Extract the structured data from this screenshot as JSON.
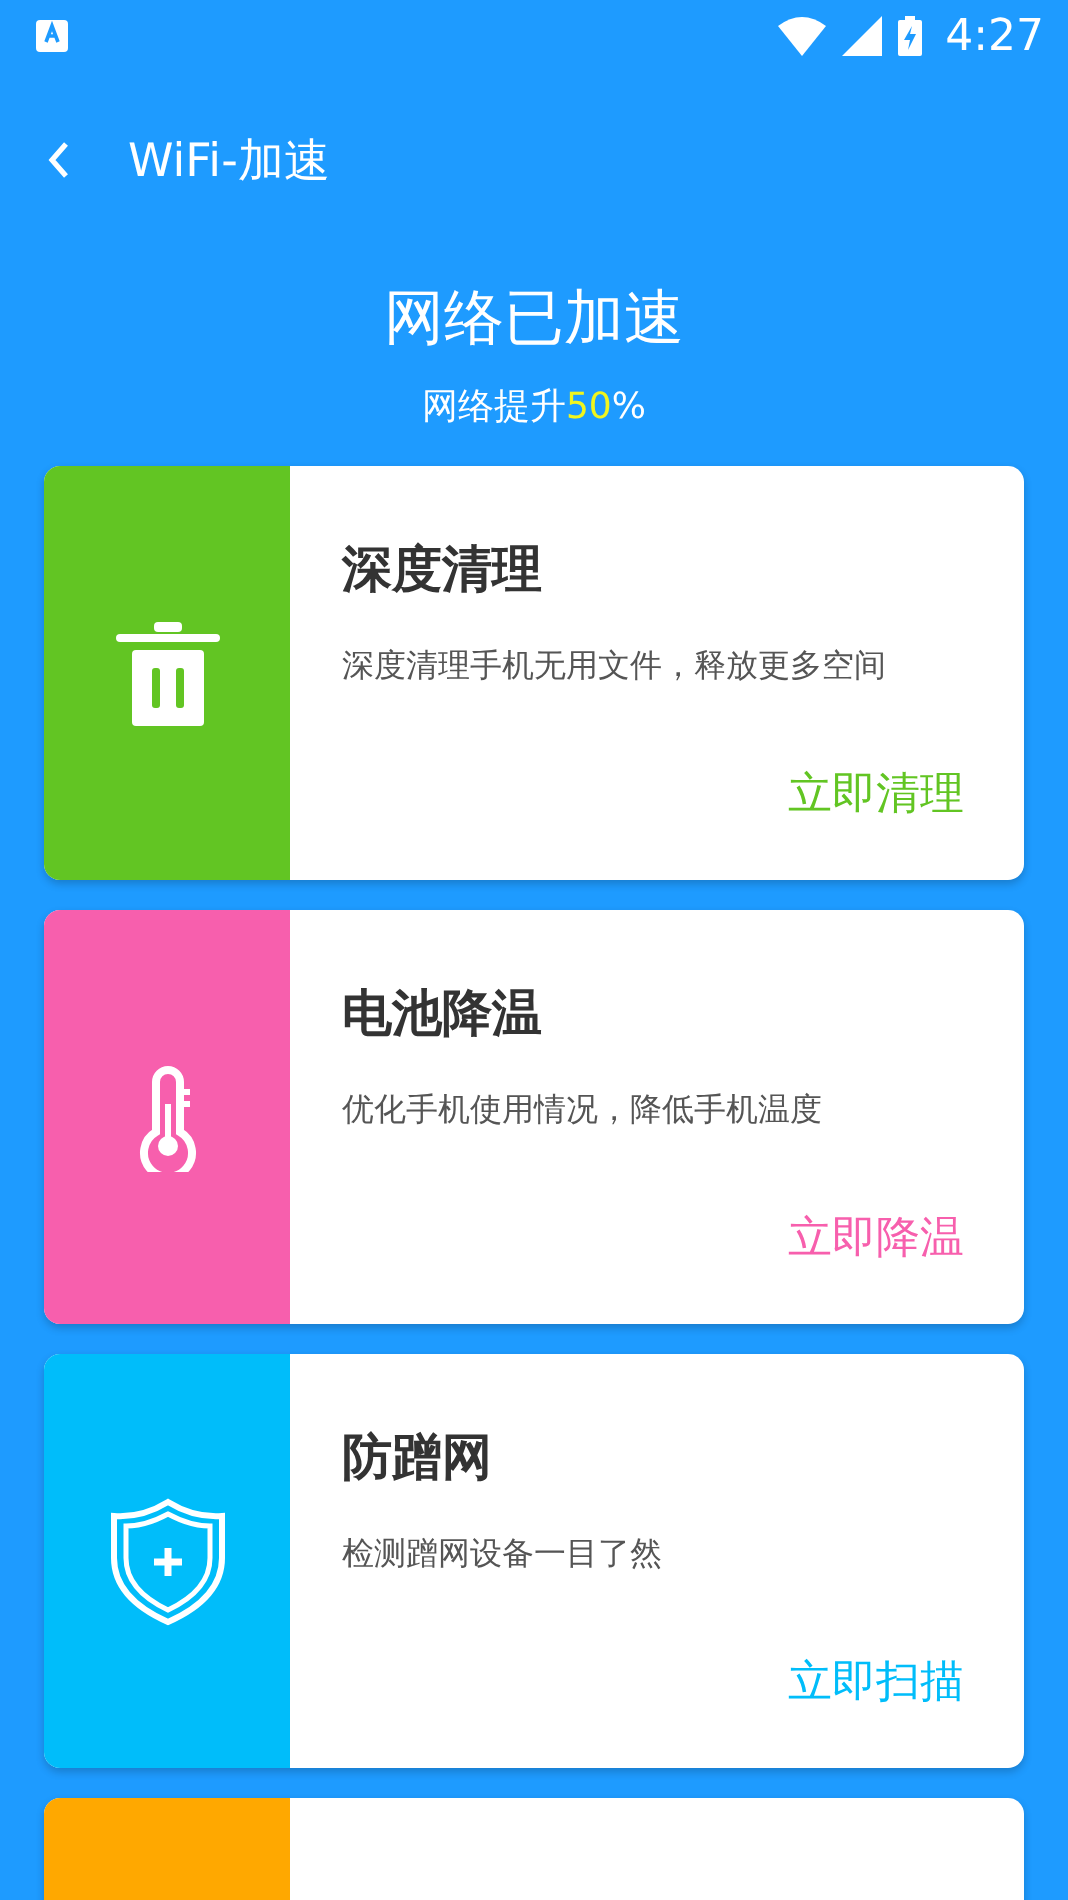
{
  "status_bar": {
    "time": "4:27"
  },
  "toolbar": {
    "title": "WiFi-加速"
  },
  "header": {
    "title": "网络已加速",
    "subtitle_prefix": "网络提升",
    "subtitle_value": "50",
    "subtitle_suffix": "%"
  },
  "cards": [
    {
      "kind": "trash",
      "color": "#62c523",
      "title": "深度清理",
      "description": "深度清理手机无用文件，释放更多空间",
      "action": "立即清理"
    },
    {
      "kind": "thermometer",
      "color": "#f75fad",
      "title": "电池降温",
      "description": "优化手机使用情况，降低手机温度",
      "action": "立即降温"
    },
    {
      "kind": "shield",
      "color": "#00bdfa",
      "title": "防蹭网",
      "description": "检测蹭网设备一目了然",
      "action": "立即扫描"
    },
    {
      "kind": "none",
      "color": "#ffa800"
    }
  ]
}
